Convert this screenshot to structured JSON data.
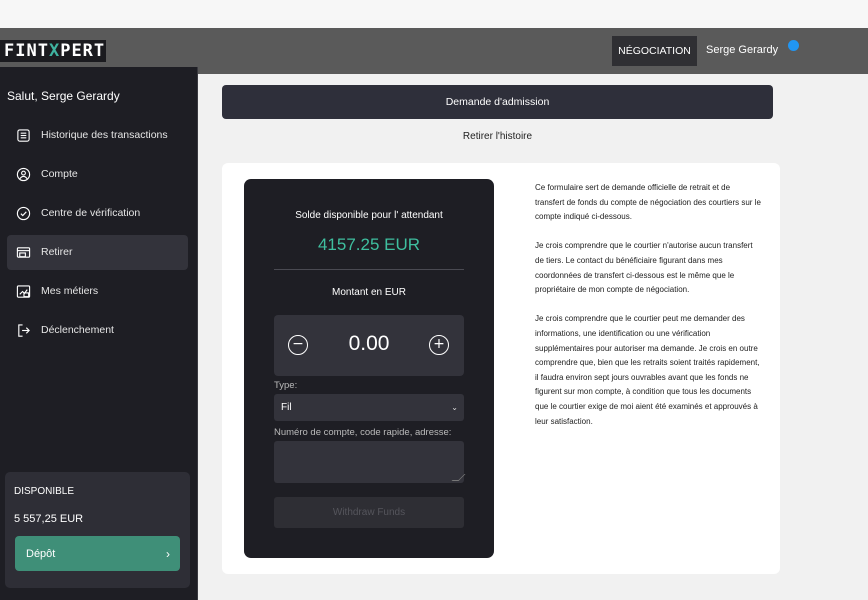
{
  "brand": {
    "logo_pre": "FINT",
    "logo_x": "X",
    "logo_post": "PERT"
  },
  "navbar": {
    "trading_label": "NÉGOCIATION",
    "user_name": "Serge Gerardy"
  },
  "sidebar": {
    "greeting": "Salut, Serge Gerardy",
    "items": [
      {
        "label": "Historique des transactions",
        "icon": "list-icon"
      },
      {
        "label": "Compte",
        "icon": "user-icon"
      },
      {
        "label": "Centre de vérification",
        "icon": "check-circle-icon"
      },
      {
        "label": "Retirer",
        "icon": "wallet-icon",
        "active": true
      },
      {
        "label": "Mes métiers",
        "icon": "chart-icon"
      },
      {
        "label": "Déclenchement",
        "icon": "logout-icon"
      }
    ],
    "available": {
      "title": "DISPONIBLE",
      "amount": "5 557,25 EUR",
      "deposit_label": "Dépôt",
      "deposit_chevron": "›"
    }
  },
  "main": {
    "banner": "Demande d'admission",
    "history_link": "Retirer l'histoire",
    "card": {
      "balance_title": "Solde disponible pour l' attendant",
      "balance_value": "4157.25 EUR",
      "amount_label": "Montant en EUR",
      "amount_value": "0.00",
      "minus_symbol": "−",
      "plus_symbol": "+",
      "type_label": "Type:",
      "type_value": "Fil",
      "account_label": "Numéro de compte, code rapide, adresse:",
      "account_value": "",
      "withdraw_label": "Withdraw Funds"
    },
    "terms": [
      "Ce formulaire sert de demande officielle de retrait et de transfert de fonds du compte de négociation des courtiers sur le compte indiqué ci-dessous.",
      "Je crois comprendre que le courtier n'autorise aucun transfert de tiers. Le contact du bénéficiaire figurant dans mes coordonnées de transfert ci-dessous est le même que le propriétaire de mon compte de négociation.",
      "Je crois comprendre que le courtier peut me demander des informations, une identification ou une vérification supplémentaires pour autoriser ma demande. Je crois en outre comprendre que, bien que les retraits soient traités rapidement, il faudra environ sept jours ouvrables avant que les fonds ne figurent sur mon compte, à condition que tous les documents que le courtier exige de moi aient été examinés et approuvés à leur satisfaction."
    ]
  },
  "colors": {
    "accent": "#3fbf9f",
    "deposit": "#3f8f78",
    "dark": "#1e1e24",
    "notify_dot": "#2196f3"
  }
}
